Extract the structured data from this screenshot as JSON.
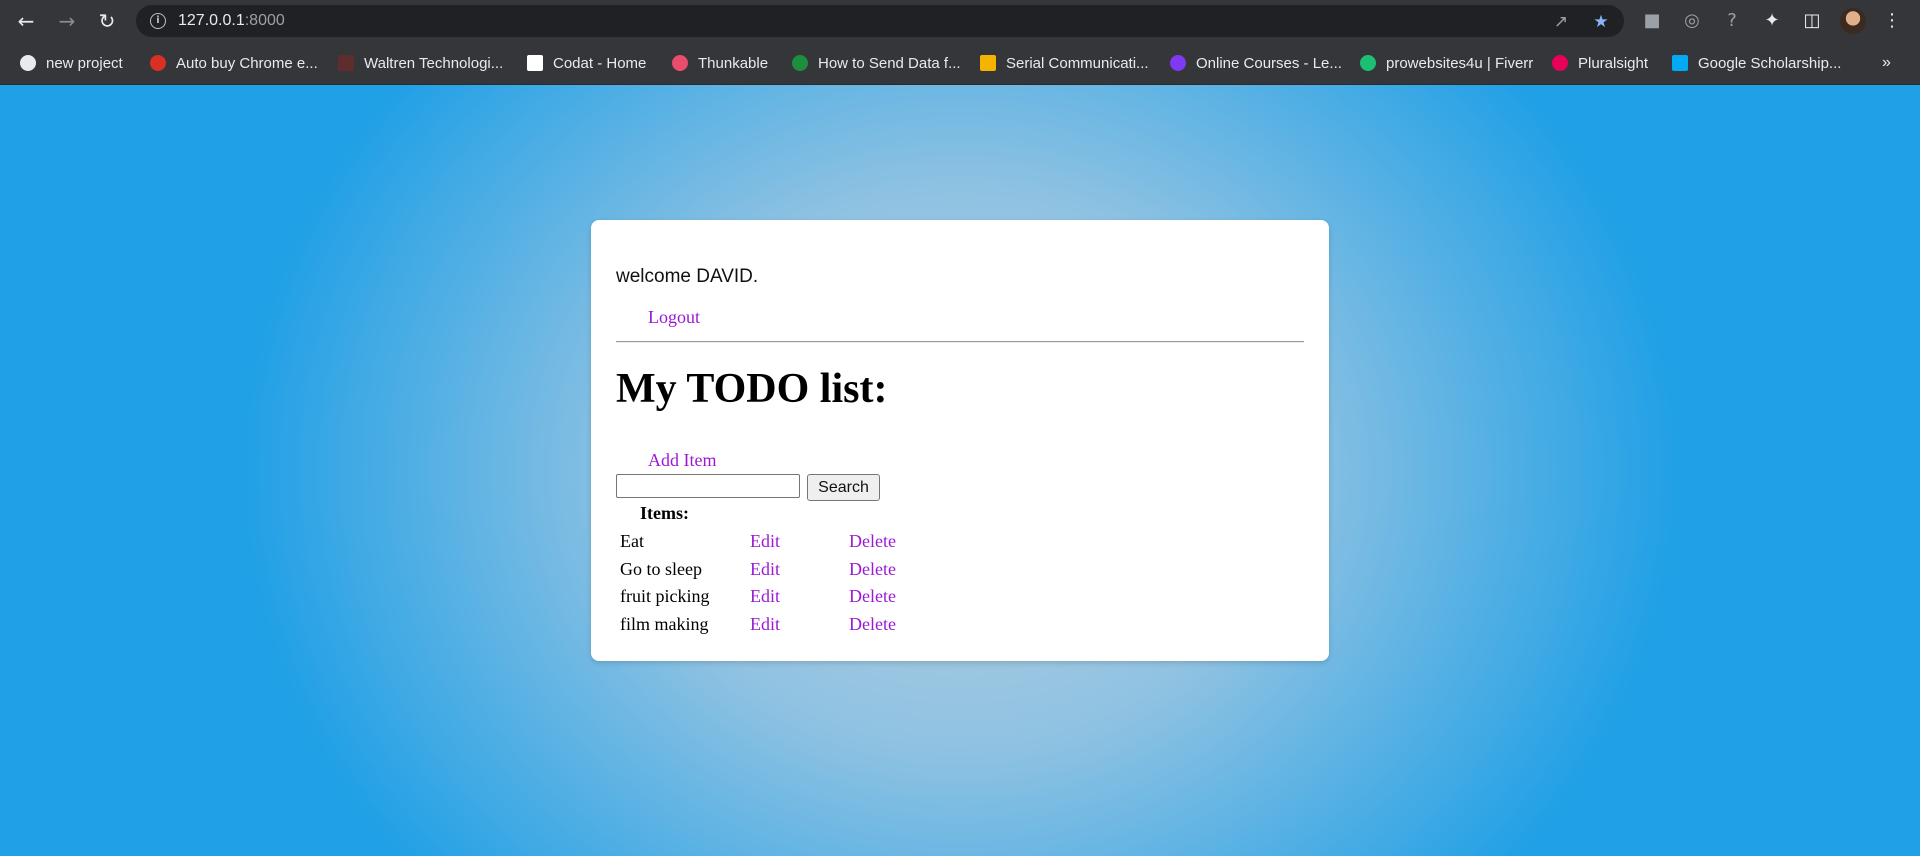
{
  "browser": {
    "url_host": "127.0.0.1",
    "url_port": ":8000",
    "bookmarks": [
      {
        "label": "new project",
        "color": "#e8eaed"
      },
      {
        "label": "Auto buy Chrome e...",
        "color": "#d93025"
      },
      {
        "label": "Waltren Technologi...",
        "color": "#5f2d2d"
      },
      {
        "label": "Codat - Home",
        "color": "#ffffff"
      },
      {
        "label": "Thunkable",
        "color": "#ea4c6b"
      },
      {
        "label": "How to Send Data f...",
        "color": "#1e8e3e"
      },
      {
        "label": "Serial Communicati...",
        "color": "#f4b400"
      },
      {
        "label": "Online Courses - Le...",
        "color": "#7e3af2"
      },
      {
        "label": "prowebsites4u | Fiverr",
        "color": "#1dbf73"
      },
      {
        "label": "Pluralsight",
        "color": "#e8005b"
      },
      {
        "label": "Google Scholarship...",
        "color": "#03a9f4"
      }
    ]
  },
  "page": {
    "welcome": "welcome DAVID.",
    "logout": "Logout",
    "title": "My TODO list:",
    "add_item": "Add Item",
    "search_button": "Search",
    "search_value": "",
    "items_label": "Items:",
    "items": [
      {
        "name": "Eat",
        "edit": "Edit",
        "delete": "Delete"
      },
      {
        "name": "Go to sleep",
        "edit": "Edit",
        "delete": "Delete"
      },
      {
        "name": "fruit picking",
        "edit": "Edit",
        "delete": "Delete"
      },
      {
        "name": "film making",
        "edit": "Edit",
        "delete": "Delete"
      }
    ],
    "link_color": "#9b19d6"
  }
}
